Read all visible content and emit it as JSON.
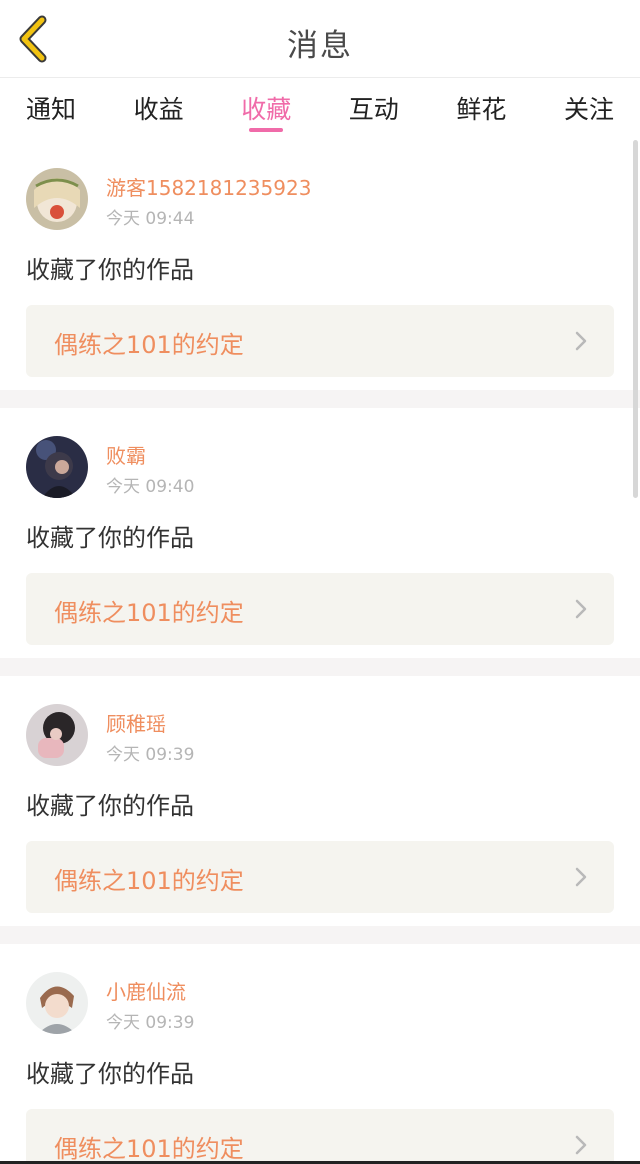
{
  "header": {
    "title": "消息",
    "back_icon": "chevron-left-icon"
  },
  "tabs": [
    {
      "label": "通知",
      "active": false
    },
    {
      "label": "收益",
      "active": false
    },
    {
      "label": "收藏",
      "active": true
    },
    {
      "label": "互动",
      "active": false
    },
    {
      "label": "鲜花",
      "active": false
    },
    {
      "label": "关注",
      "active": false
    }
  ],
  "items": [
    {
      "username": "游客1582181235923",
      "time": "今天 09:44",
      "action": "收藏了你的作品",
      "work": "偶练之101的约定"
    },
    {
      "username": "败霸",
      "time": "今天 09:40",
      "action": "收藏了你的作品",
      "work": "偶练之101的约定"
    },
    {
      "username": "顾稚瑶",
      "time": "今天 09:39",
      "action": "收藏了你的作品",
      "work": "偶练之101的约定"
    },
    {
      "username": "小鹿仙流",
      "time": "今天 09:39",
      "action": "收藏了你的作品",
      "work": "偶练之101的约定"
    }
  ],
  "colors": {
    "accent_pink": "#f06ba9",
    "accent_orange": "#ef8e5f",
    "back_icon_yellow": "#f2c311"
  }
}
